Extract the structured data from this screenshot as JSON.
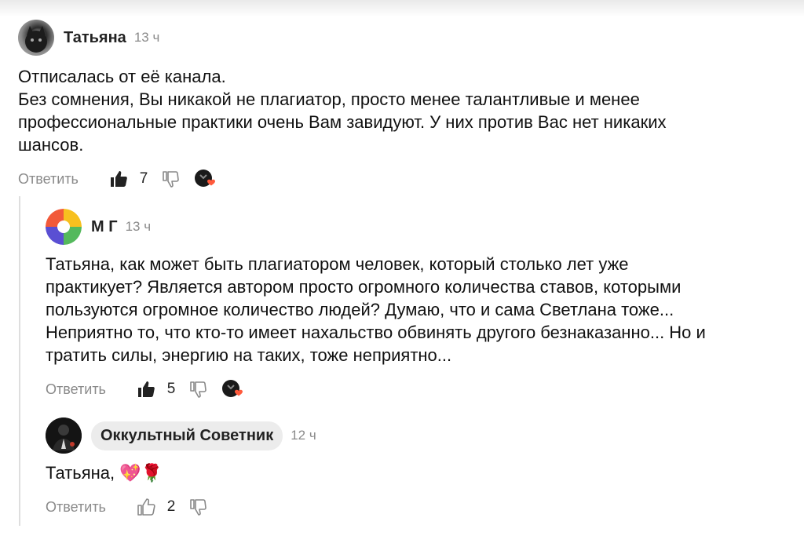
{
  "comments": [
    {
      "author": "Татьяна",
      "time": "13 ч",
      "text": "Отписалась от её канала.\nБез сомнения, Вы никакой не плагиатор, просто менее талантливые и менее\nпрофессиональные практики очень Вам завидуют. У них против Вас нет никаких\nшансов.",
      "reply_label": "Ответить",
      "likes": "7",
      "liked": true,
      "author_reacted": true
    },
    {
      "author": "М Г",
      "time": "13 ч",
      "text": "Татьяна, как может быть плагиатором человек, который столько лет уже\nпрактикует? Является автором просто огромного количества ставов, которыми\nпользуются огромное количество людей? Думаю, что и сама Светлана тоже...\nНеприятно то, что кто-то имеет нахальство обвинять другого безнаказанно... Но и\nтратить силы, энергию на таких, тоже неприятно...",
      "reply_label": "Ответить",
      "likes": "5",
      "liked": true,
      "author_reacted": true
    },
    {
      "author": "Оккультный Советник",
      "time": "12 ч",
      "text": "Татьяна, ",
      "emoji": "💖🌹",
      "reply_label": "Ответить",
      "likes": "2",
      "liked": false,
      "author_reacted": false
    }
  ],
  "colors": {
    "text": "#111111",
    "muted": "#8a8a8a",
    "heart": "#ff5a3c",
    "pill_bg": "#ececec"
  },
  "icons": [
    "thumbs-up-icon",
    "thumbs-down-icon",
    "author-heart-badge-icon"
  ]
}
